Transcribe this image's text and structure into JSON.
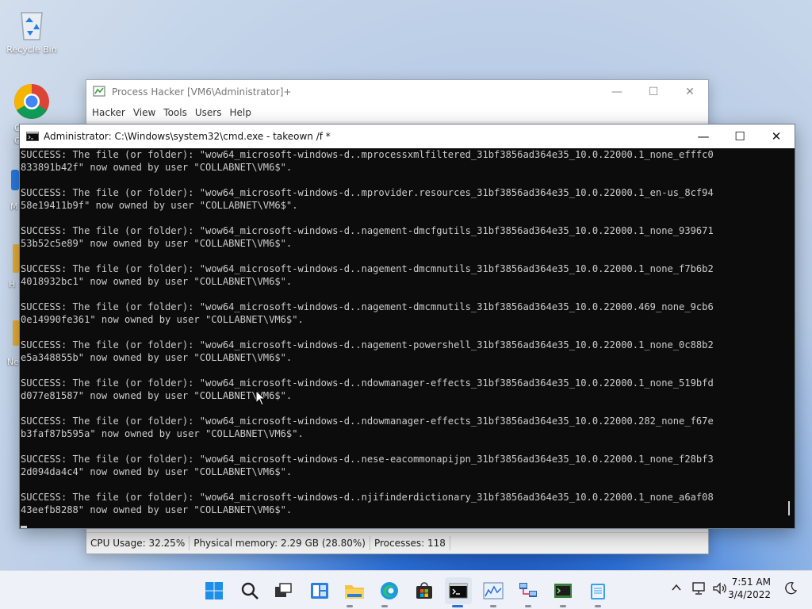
{
  "desktop": {
    "recycle_bin_label": "Recycle Bin",
    "partial_labels": [
      "C",
      "C",
      "M",
      "H",
      "Ne"
    ]
  },
  "process_hacker": {
    "title": "Process Hacker [VM6\\Administrator]+",
    "menu": [
      "Hacker",
      "View",
      "Tools",
      "Users",
      "Help"
    ],
    "status": {
      "cpu": "CPU Usage: 32.25%",
      "memory": "Physical memory: 2.29 GB (28.80%)",
      "processes": "Processes: 118"
    }
  },
  "cmd": {
    "title": "Administrator: C:\\Windows\\system32\\cmd.exe - takeown  /f *",
    "lines": [
      "SUCCESS: The file (or folder): \"wow64_microsoft-windows-d..mprocessxmlfiltered_31bf3856ad364e35_10.0.22000.1_none_efffc0\n833891b42f\" now owned by user \"COLLABNET\\VM6$\".",
      "SUCCESS: The file (or folder): \"wow64_microsoft-windows-d..mprovider.resources_31bf3856ad364e35_10.0.22000.1_en-us_8cf94\n58e19411b9f\" now owned by user \"COLLABNET\\VM6$\".",
      "SUCCESS: The file (or folder): \"wow64_microsoft-windows-d..nagement-dmcfgutils_31bf3856ad364e35_10.0.22000.1_none_939671\n53b52c5e89\" now owned by user \"COLLABNET\\VM6$\".",
      "SUCCESS: The file (or folder): \"wow64_microsoft-windows-d..nagement-dmcmnutils_31bf3856ad364e35_10.0.22000.1_none_f7b6b2\n4018932bc1\" now owned by user \"COLLABNET\\VM6$\".",
      "SUCCESS: The file (or folder): \"wow64_microsoft-windows-d..nagement-dmcmnutils_31bf3856ad364e35_10.0.22000.469_none_9cb6\n0e14990fe361\" now owned by user \"COLLABNET\\VM6$\".",
      "SUCCESS: The file (or folder): \"wow64_microsoft-windows-d..nagement-powershell_31bf3856ad364e35_10.0.22000.1_none_0c88b2\ne5a348855b\" now owned by user \"COLLABNET\\VM6$\".",
      "SUCCESS: The file (or folder): \"wow64_microsoft-windows-d..ndowmanager-effects_31bf3856ad364e35_10.0.22000.1_none_519bfd\nd077e81587\" now owned by user \"COLLABNET\\VM6$\".",
      "SUCCESS: The file (or folder): \"wow64_microsoft-windows-d..ndowmanager-effects_31bf3856ad364e35_10.0.22000.282_none_f67e\nb3faf87b595a\" now owned by user \"COLLABNET\\VM6$\".",
      "SUCCESS: The file (or folder): \"wow64_microsoft-windows-d..nese-eacommonapijpn_31bf3856ad364e35_10.0.22000.1_none_f28bf3\n2d094da4c4\" now owned by user \"COLLABNET\\VM6$\".",
      "SUCCESS: The file (or folder): \"wow64_microsoft-windows-d..njifinderdictionary_31bf3856ad364e35_10.0.22000.1_none_a6af08\n43eefb8288\" now owned by user \"COLLABNET\\VM6$\"."
    ]
  },
  "taskbar": {
    "icons": [
      "start-icon",
      "search-icon",
      "task-view-icon",
      "widgets-icon",
      "file-explorer-icon",
      "edge-icon",
      "store-icon",
      "cmd-icon",
      "process-hacker-icon",
      "network-icon",
      "terminal-app-icon",
      "notepad-icon"
    ],
    "time": "7:51 AM",
    "date": "3/4/2022"
  },
  "colors": {
    "accent": "#2b6cd6",
    "console_bg": "#0c0c0c",
    "console_text": "#cccccc"
  }
}
